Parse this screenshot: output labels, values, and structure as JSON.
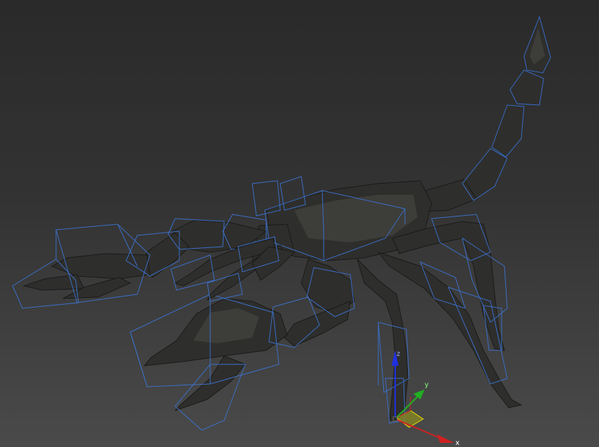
{
  "viewport": {
    "background_top": "#2a2a2a",
    "background_bottom": "#4a4a4a",
    "model": "scorpion",
    "bone_color": "#3b6fc7"
  },
  "gizmo": {
    "axes": [
      {
        "label": "x",
        "color": "#d02020"
      },
      {
        "label": "y",
        "color": "#20b020"
      },
      {
        "label": "z",
        "color": "#2030e0"
      }
    ],
    "plane_color": "#e8e000"
  }
}
